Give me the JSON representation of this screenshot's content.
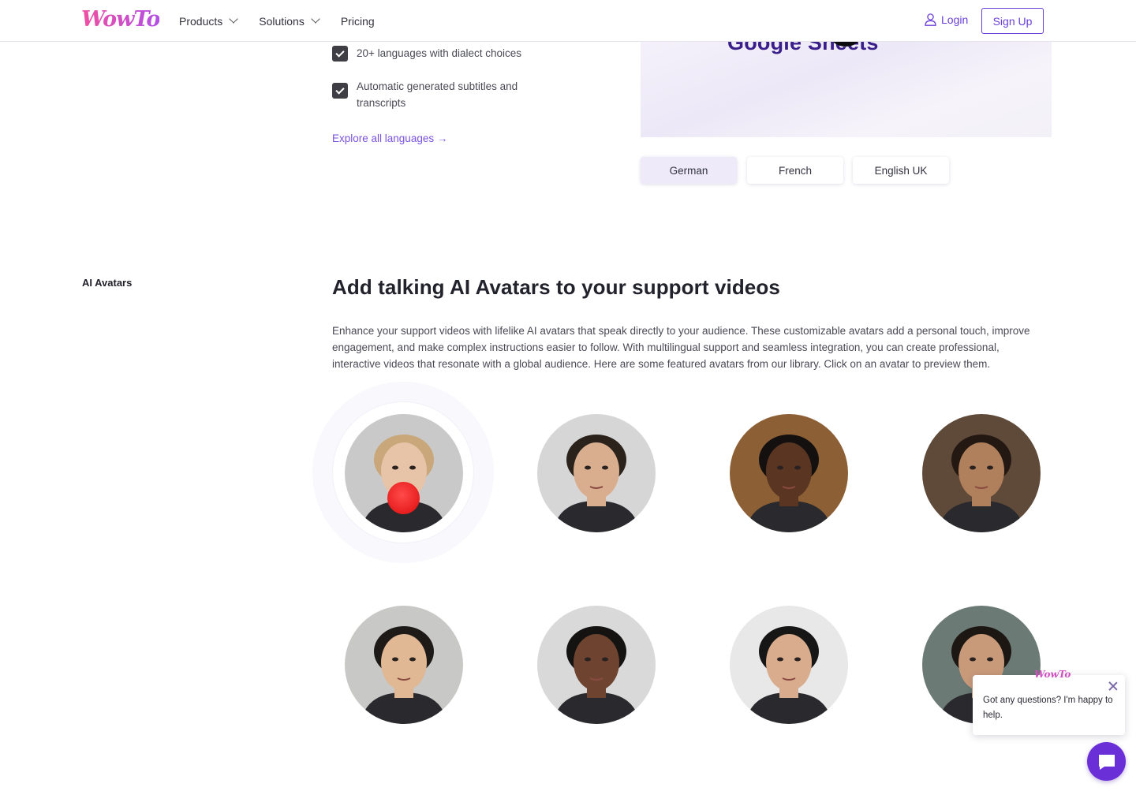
{
  "header": {
    "logo": "WowTo",
    "nav": [
      {
        "label": "Products",
        "has_dropdown": true
      },
      {
        "label": "Solutions",
        "has_dropdown": true
      },
      {
        "label": "Pricing",
        "has_dropdown": false
      }
    ],
    "login_label": "Login",
    "signup_label": "Sign Up",
    "brand_color": "#6a3fd8"
  },
  "languages": {
    "features": [
      "20+ languages with dialect choices",
      "Automatic generated subtitles and transcripts"
    ],
    "explore_link": "Explore all languages →",
    "preview_text": "Google Sheets",
    "options": [
      "German",
      "French",
      "English UK"
    ],
    "selected": "German"
  },
  "ai_avatars": {
    "label": "AI Avatars",
    "title": "Add talking AI Avatars to your support videos",
    "description": "Enhance your support videos with lifelike AI avatars that speak directly to your audience. These customizable avatars add a personal touch, improve engagement, and make complex instructions easier to follow. With multilingual support and seamless integration, you can create professional, interactive videos that resonate with a global audience. Here are some featured avatars from our library. Click on an avatar to preview them.",
    "avatars": [
      {
        "name": "avatar-1",
        "selected": true,
        "bg": "#c9c9c9",
        "skin": "#e7c3a8",
        "hair": "#c9a77a"
      },
      {
        "name": "avatar-2",
        "selected": false,
        "bg": "#d6d6d6",
        "skin": "#d9ae8f",
        "hair": "#2b221c"
      },
      {
        "name": "avatar-3",
        "selected": false,
        "bg": "#8d5f35",
        "skin": "#5a3522",
        "hair": "#141010"
      },
      {
        "name": "avatar-4",
        "selected": false,
        "bg": "#5f4a3a",
        "skin": "#b07f5c",
        "hair": "#241812"
      },
      {
        "name": "avatar-5",
        "selected": false,
        "bg": "#c8c8c6",
        "skin": "#e0b894",
        "hair": "#1e1a18"
      },
      {
        "name": "avatar-6",
        "selected": false,
        "bg": "#d9d9d9",
        "skin": "#6e4430",
        "hair": "#151212"
      },
      {
        "name": "avatar-7",
        "selected": false,
        "bg": "#e8e8e8",
        "skin": "#d8ac8c",
        "hair": "#161616"
      },
      {
        "name": "avatar-8",
        "selected": false,
        "bg": "#6b7a74",
        "skin": "#c99a7a",
        "hair": "#1d1714"
      }
    ]
  },
  "chat": {
    "logo": "WowTo",
    "message": "Got any questions? I'm happy to help.",
    "accent": "#6a2fd6"
  }
}
